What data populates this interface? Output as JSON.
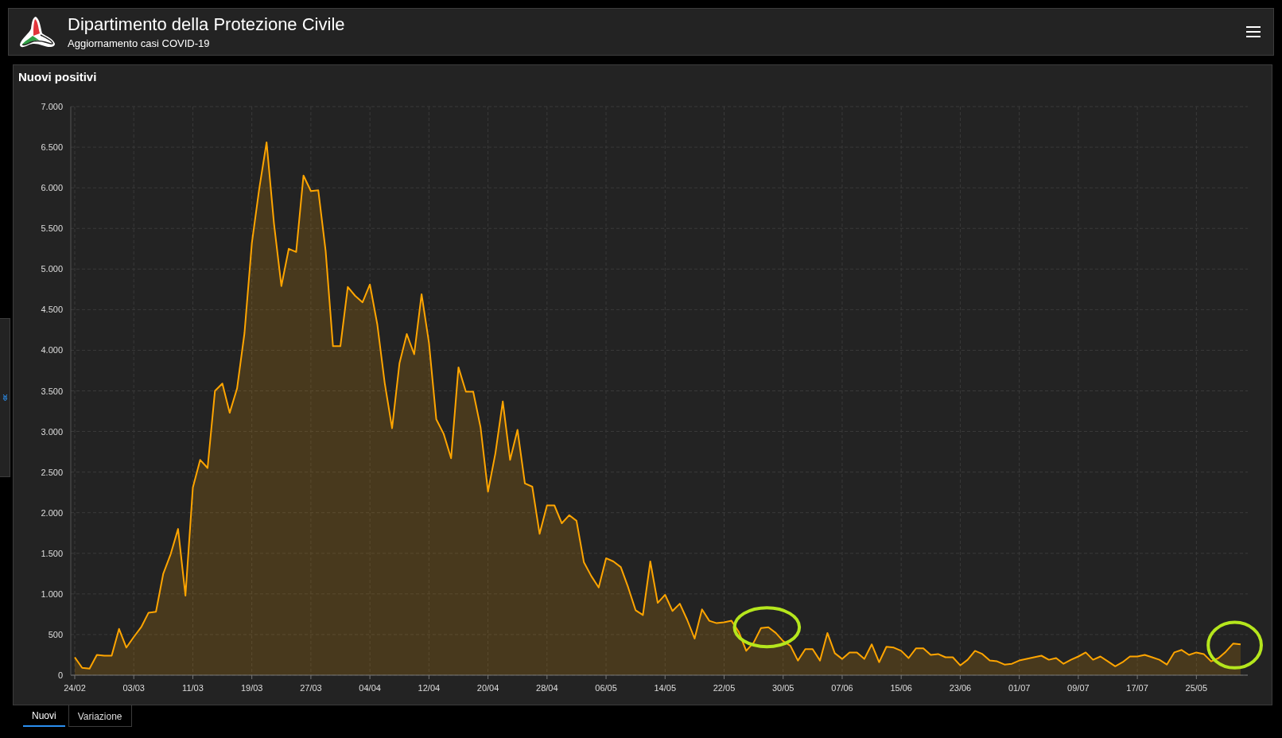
{
  "header": {
    "title": "Dipartimento della Protezione Civile",
    "subtitle": "Aggiornamento casi COVID-19"
  },
  "panel": {
    "title": "Nuovi positivi",
    "chart_data": {
      "type": "area",
      "grid": true,
      "categories": [
        "24/02",
        null,
        null,
        null,
        null,
        null,
        null,
        null,
        "03/03",
        null,
        null,
        null,
        null,
        null,
        null,
        null,
        "11/03",
        null,
        null,
        null,
        null,
        null,
        null,
        null,
        "19/03",
        null,
        null,
        null,
        null,
        null,
        null,
        null,
        "27/03",
        null,
        null,
        null,
        null,
        null,
        null,
        null,
        "04/04",
        null,
        null,
        null,
        null,
        null,
        null,
        null,
        "12/04",
        null,
        null,
        null,
        null,
        null,
        null,
        null,
        "20/04",
        null,
        null,
        null,
        null,
        null,
        null,
        null,
        "28/04",
        null,
        null,
        null,
        null,
        null,
        null,
        null,
        "06/05",
        null,
        null,
        null,
        null,
        null,
        null,
        null,
        "14/05",
        null,
        null,
        null,
        null,
        null,
        null,
        null,
        "22/05",
        null,
        null,
        null,
        null,
        null,
        null,
        null,
        "30/05",
        null,
        null,
        null,
        null,
        null,
        null,
        null,
        "07/06",
        null,
        null,
        null,
        null,
        null,
        null,
        null,
        "15/06",
        null,
        null,
        null,
        null,
        null,
        null,
        null,
        "23/06",
        null,
        null,
        null,
        null,
        null,
        null,
        null,
        "01/07",
        null,
        null,
        null,
        null,
        null,
        null,
        null,
        "09/07",
        null,
        null,
        null,
        null,
        null,
        null,
        null,
        "17/07",
        null,
        null,
        null,
        null,
        null,
        null,
        null,
        "25/05",
        null,
        null,
        null,
        null,
        null,
        null
      ],
      "series": [
        {
          "color": "#ffa500",
          "values": [
            220,
            90,
            80,
            250,
            240,
            240,
            570,
            340,
            470,
            590,
            770,
            780,
            1250,
            1490,
            1800,
            980,
            2310,
            2650,
            2550,
            3500,
            3590,
            3230,
            3530,
            4210,
            5320,
            5990,
            6560,
            5560,
            4790,
            5250,
            5210,
            6150,
            5960,
            5970,
            5220,
            4050,
            4050,
            4780,
            4670,
            4590,
            4810,
            4320,
            3600,
            3040,
            3840,
            4200,
            3950,
            4690,
            4090,
            3150,
            2970,
            2670,
            3790,
            3490,
            3490,
            3050,
            2260,
            2730,
            3370,
            2650,
            3020,
            2360,
            2320,
            1740,
            2090,
            2090,
            1870,
            1970,
            1900,
            1390,
            1220,
            1080,
            1440,
            1400,
            1330,
            1080,
            800,
            740,
            1400,
            890,
            990,
            790,
            880,
            680,
            450,
            810,
            670,
            640,
            650,
            670,
            530,
            300,
            400,
            580,
            590,
            520,
            420,
            360,
            180,
            320,
            320,
            180,
            520,
            270,
            200,
            280,
            280,
            200,
            380,
            160,
            350,
            340,
            300,
            210,
            330,
            330,
            250,
            260,
            220,
            220,
            120,
            190,
            300,
            260,
            180,
            170,
            130,
            140,
            180,
            200,
            220,
            240,
            190,
            210,
            140,
            190,
            230,
            280,
            190,
            230,
            170,
            110,
            160,
            230,
            230,
            250,
            220,
            190,
            130,
            280,
            310,
            250,
            280,
            260,
            170,
            210,
            290,
            390,
            380
          ]
        }
      ],
      "ylim": [
        0,
        7000
      ],
      "yticks": [
        {
          "value": 0,
          "label": "0"
        },
        {
          "value": 500,
          "label": "500"
        },
        {
          "value": 1000,
          "label": "1.000"
        },
        {
          "value": 1500,
          "label": "1.500"
        },
        {
          "value": 2000,
          "label": "2.000"
        },
        {
          "value": 2500,
          "label": "2.500"
        },
        {
          "value": 3000,
          "label": "3.000"
        },
        {
          "value": 3500,
          "label": "3.500"
        },
        {
          "value": 4000,
          "label": "4.000"
        },
        {
          "value": 4500,
          "label": "4.500"
        },
        {
          "value": 5000,
          "label": "5.000"
        },
        {
          "value": 5500,
          "label": "5.500"
        },
        {
          "value": 6000,
          "label": "6.000"
        },
        {
          "value": 6500,
          "label": "6.500"
        },
        {
          "value": 7000,
          "label": "7.000"
        }
      ]
    }
  },
  "tabs": [
    {
      "label": "Nuovi",
      "selected": true
    },
    {
      "label": "Variazione",
      "selected": false
    }
  ]
}
